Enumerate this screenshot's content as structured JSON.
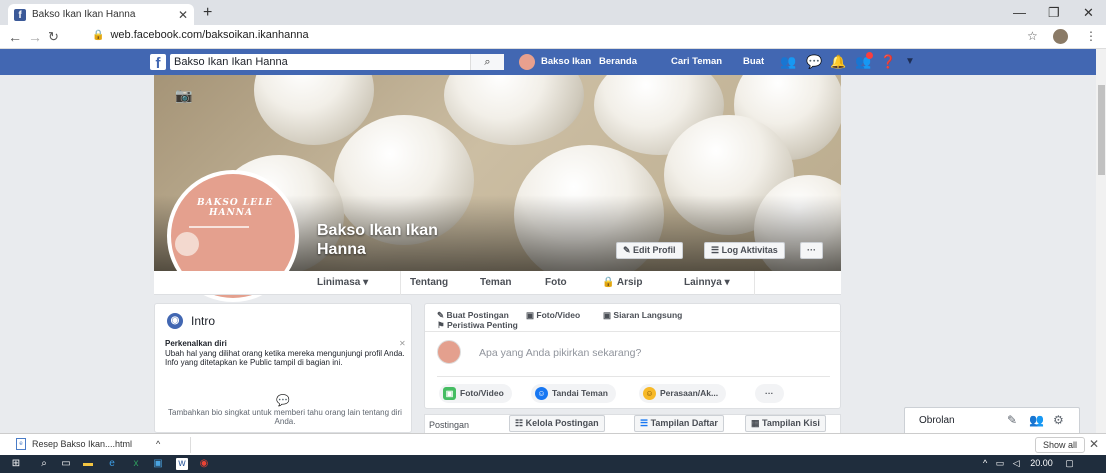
{
  "browser": {
    "tab_title": "Bakso Ikan Ikan Hanna",
    "url": "web.facebook.com/baksoikan.ikanhanna"
  },
  "fb_header": {
    "search_value": "Bakso Ikan Ikan Hanna",
    "profile_name": "Bakso Ikan",
    "nav": [
      "Beranda",
      "Cari Teman",
      "Buat"
    ]
  },
  "cover": {
    "page_name_line1": "Bakso Ikan Ikan",
    "page_name_line2": "Hanna",
    "profile_logo_line1": "BAKSO LELE",
    "profile_logo_line2": "HANNA",
    "edit_profile": "Edit Profil",
    "activity_log": "Log Aktivitas",
    "more": "···"
  },
  "page_nav": {
    "timeline": "Linimasa ▾",
    "about": "Tentang",
    "friends": "Teman",
    "photos": "Foto",
    "archive": "Arsip",
    "more": "Lainnya ▾"
  },
  "intro": {
    "title": "Intro",
    "subtitle": "Perkenalkan diri",
    "description": "Ubah hal yang dilihat orang ketika mereka mengunjungi profil Anda. Info yang ditetapkan ke Public tampil di bagian ini.",
    "bio_prompt": "Tambahkan bio singkat untuk memberi tahu orang lain tentang diri Anda."
  },
  "composer": {
    "tab_create_post": "Buat Postingan",
    "tab_photo_video": "Foto/Video",
    "tab_live": "Siaran Langsung",
    "tab_life_event": "Peristiwa Penting",
    "placeholder": "Apa yang Anda pikirkan sekarang?",
    "btn_photo_video": "Foto/Video",
    "btn_tag_friends": "Tandai Teman",
    "btn_feeling": "Perasaan/Ak...",
    "btn_more": "···"
  },
  "posts": {
    "title": "Postingan",
    "manage": "Kelola Postingan",
    "list_view": "Tampilan Daftar",
    "grid_view": "Tampilan Kisi"
  },
  "chat": {
    "title": "Obrolan"
  },
  "downloads": {
    "file": "Resep Bakso Ikan....html",
    "show_all": "Show all"
  },
  "taskbar": {
    "time": "20.00"
  }
}
